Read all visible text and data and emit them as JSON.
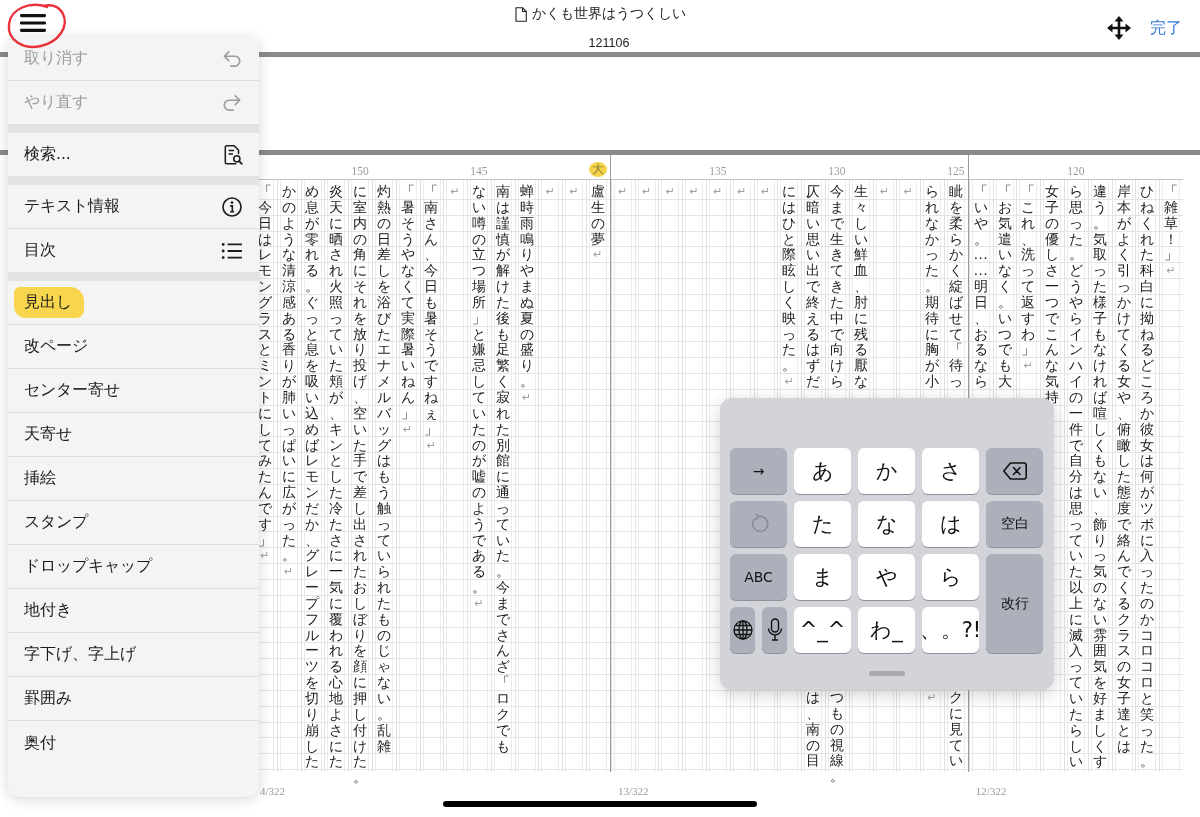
{
  "header": {
    "title": "かくも世界はうつくしい",
    "subtitle": "121106",
    "done": "完了"
  },
  "pages": [
    {
      "label": "4/322",
      "columns": [
        {
          "text": "「今日はレモングラスとミントにしてみたんです」",
          "mark": "↵"
        },
        {
          "text": "かのような清涼感ある香りが肺いっぱいに広がった。",
          "mark": "↵"
        },
        {
          "text": "め息が零れる。ぐっと息を吸い込めばレモンだか、グレープフルーツを切り崩した"
        },
        {
          "text": "炎天に晒され火照っていた頬が、キンとした冷たさに一気に覆われる心地よさにた"
        },
        {
          "ruler": {
            "label": "150",
            "highlighted": false
          },
          "text": "に室内の角にそれを放り投げ、空いた手で差し出されたおしぼりを顔に押し付けた。"
        },
        {
          "text": "灼熱の日差しを浴びたエナメルバッグはもう触っていられたものじゃない。乱雑"
        },
        {
          "text": "「暑そうやなくて実際暑いねん」",
          "mark": "↵"
        },
        {
          "text": "「南さん、今日も暑そうですねぇ」",
          "mark": "↵"
        },
        {
          "mark": "↵"
        },
        {
          "ruler": {
            "label": "145",
            "highlighted": false
          },
          "text": "ない噂の立つ場所」と嫌忌していたのが嘘のようである。",
          "mark": "↵"
        },
        {
          "text": "南は謹慎が解けた後も足繁く寂れた別館に通っていた。今までさんざ「ロクでも"
        },
        {
          "text": "蝉時雨鳴りやまぬ夏の盛り。",
          "mark": "↵"
        },
        {
          "mark": "↵"
        },
        {
          "mark": "↵"
        },
        {
          "ruler": {
            "label": "大",
            "highlighted": true
          },
          "text": "盧生の夢",
          "mark": "↵"
        }
      ]
    },
    {
      "label": "13/322",
      "columns": [
        {
          "mark": "↵"
        },
        {
          "mark": "↵"
        },
        {
          "mark": "↵"
        },
        {
          "mark": "↵"
        },
        {
          "ruler": {
            "label": "135",
            "highlighted": false
          },
          "mark": "↵"
        },
        {
          "mark": "↵"
        },
        {
          "mark": "↵"
        },
        {
          "text": "にはひと際眩しく映った。",
          "mark": "↵"
        },
        {
          "text": "仄暗い思い出で終えるはずだ",
          "bottom_text": "は、南の目"
        },
        {
          "ruler": {
            "label": "130",
            "highlighted": false
          },
          "text": "今まで生きてきた中で向けら",
          "bottom_text": "つもの視線。"
        },
        {
          "text": "生々しい鮮血、肘に残る厭な"
        },
        {
          "mark": "↵"
        },
        {
          "mark": "↵"
        },
        {
          "text": "られなかった。期待に胸が小",
          "bottom_mark": "↵"
        },
        {
          "ruler": {
            "label": "125",
            "highlighted": false
          },
          "text": "眦を柔らかく綻ばせて「待っ",
          "bottom_text": "クに見てい"
        }
      ]
    },
    {
      "label": "12/322",
      "columns": [
        {
          "text": "「いや。……明日、おるなら"
        },
        {
          "text": "「お気遣いなく。いつでも大"
        },
        {
          "text": "「これ、洗って返すわ」",
          "mark": "↵"
        },
        {
          "text": "女子の優しさ一つでこんな気持"
        },
        {
          "ruler": {
            "label": "120",
            "highlighted": false
          },
          "text": "ら思った。どうやらインハイの一件で自分は思っていた以上に滅入っていたらしい"
        },
        {
          "text": "違う。気取った様子もなければ喧しくもない、飾りっ気のない雰囲気を好ましくす"
        },
        {
          "text": "岸本がよく引っかけてくる女や、俯瞰した態度で絡んでくるクラスの女子達とは"
        },
        {
          "text": "ひねくれた科白に拗ねるどころか彼女は何がツボに入ったのかコロコロと笑った。"
        },
        {
          "text": "「雑草！」",
          "mark": "↵"
        }
      ]
    }
  ],
  "menu": {
    "groups": [
      [
        {
          "label": "取り消す",
          "kind": "undo",
          "disabled": true
        },
        {
          "label": "やり直す",
          "kind": "redo",
          "disabled": true
        }
      ],
      [
        {
          "label": "検索...",
          "kind": "search",
          "disabled": false
        }
      ],
      [
        {
          "label": "テキスト情報",
          "kind": "info",
          "disabled": false
        },
        {
          "label": "目次",
          "kind": "list",
          "disabled": false
        }
      ],
      [
        {
          "label": "見出し",
          "kind": "plain",
          "disabled": false,
          "highlighted": true
        },
        {
          "label": "改ページ",
          "kind": "plain",
          "disabled": false
        },
        {
          "label": "センター寄せ",
          "kind": "plain",
          "disabled": false
        },
        {
          "label": "天寄せ",
          "kind": "plain",
          "disabled": false
        },
        {
          "label": "挿絵",
          "kind": "plain",
          "disabled": false
        },
        {
          "label": "スタンプ",
          "kind": "plain",
          "disabled": false
        },
        {
          "label": "ドロップキャップ",
          "kind": "plain",
          "disabled": false
        },
        {
          "label": "地付き",
          "kind": "plain",
          "disabled": false
        },
        {
          "label": "字下げ、字上げ",
          "kind": "plain",
          "disabled": false
        },
        {
          "label": "罫囲み",
          "kind": "plain",
          "disabled": false
        },
        {
          "label": "奥付",
          "kind": "plain",
          "disabled": false
        }
      ]
    ]
  },
  "keyboard": {
    "keys": [
      {
        "kind": "fn",
        "label": "→"
      },
      {
        "kind": "char",
        "label": "あ"
      },
      {
        "kind": "char",
        "label": "か"
      },
      {
        "kind": "char",
        "label": "さ"
      },
      {
        "kind": "delete"
      },
      {
        "kind": "undo"
      },
      {
        "kind": "char",
        "label": "た"
      },
      {
        "kind": "char",
        "label": "な"
      },
      {
        "kind": "char",
        "label": "は"
      },
      {
        "kind": "fn",
        "label": "空白"
      },
      {
        "kind": "fn",
        "label": "ABC"
      },
      {
        "kind": "char",
        "label": "ま"
      },
      {
        "kind": "char",
        "label": "や"
      },
      {
        "kind": "char",
        "label": "ら"
      },
      {
        "kind": "tall",
        "label": "改行"
      },
      {
        "kind": "globe"
      },
      {
        "kind": "mic"
      },
      {
        "kind": "char",
        "label": "^_^"
      },
      {
        "kind": "char",
        "label": "わ_"
      },
      {
        "kind": "char",
        "label": "、。?!"
      }
    ]
  }
}
